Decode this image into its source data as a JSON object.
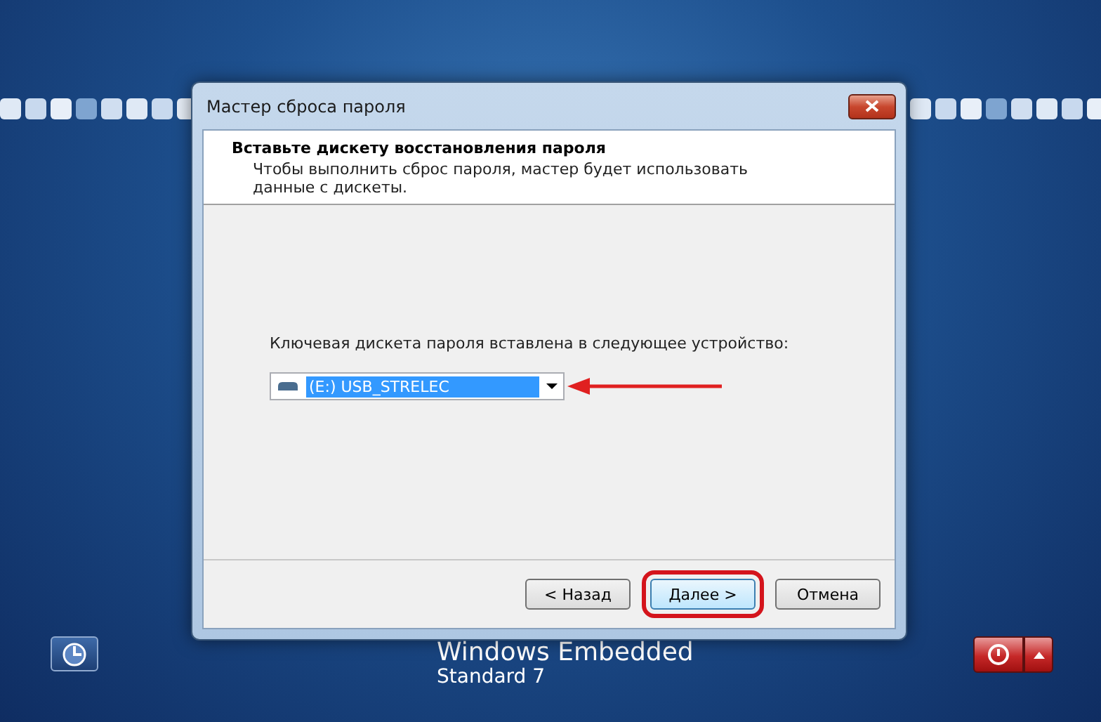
{
  "window": {
    "title": "Мастер сброса пароля"
  },
  "header": {
    "title": "Вставьте дискету восстановления пароля",
    "description": "Чтобы выполнить сброс пароля, мастер будет использовать данные с дискеты."
  },
  "device": {
    "label": "Ключевая дискета пароля вставлена в следующее устройство:",
    "value": "(E:) USB_STRELEC",
    "arrow": true
  },
  "buttons": [
    {
      "label": "< Назад",
      "highlighted": false
    },
    {
      "label": "Далее >",
      "highlighted": true
    },
    {
      "label": "Отмена",
      "highlighted": false
    }
  ],
  "brand": {
    "name": "Windows Embedded",
    "edition": "Standard 7"
  }
}
